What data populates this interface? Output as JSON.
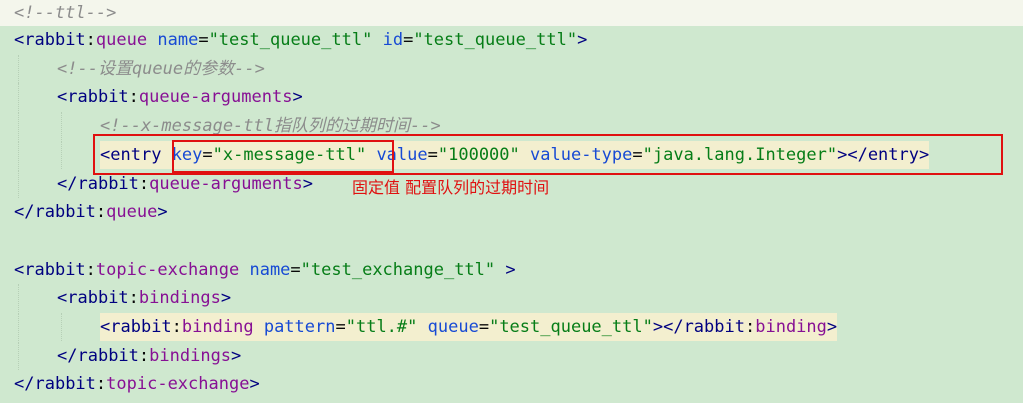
{
  "lines": [
    {
      "indent": 0,
      "tokens": [
        {
          "t": "<!--ttl-->",
          "c": "cm"
        }
      ]
    },
    {
      "indent": 0,
      "tokens": [
        {
          "t": "<",
          "c": "tg"
        },
        {
          "t": "rabbit",
          "c": "tg"
        },
        {
          "t": ":",
          "c": "pl"
        },
        {
          "t": "queue",
          "c": "ns"
        },
        {
          "t": " ",
          "c": "pl"
        },
        {
          "t": "name",
          "c": "an"
        },
        {
          "t": "=",
          "c": "pl"
        },
        {
          "t": "\"test_queue_ttl\"",
          "c": "av"
        },
        {
          "t": " ",
          "c": "pl"
        },
        {
          "t": "id",
          "c": "an"
        },
        {
          "t": "=",
          "c": "pl"
        },
        {
          "t": "\"test_queue_ttl\"",
          "c": "av"
        },
        {
          "t": ">",
          "c": "tg"
        }
      ]
    },
    {
      "indent": 1,
      "tokens": [
        {
          "t": "<!--设置queue的参数-->",
          "c": "cm"
        }
      ]
    },
    {
      "indent": 1,
      "tokens": [
        {
          "t": "<",
          "c": "tg"
        },
        {
          "t": "rabbit",
          "c": "tg"
        },
        {
          "t": ":",
          "c": "pl"
        },
        {
          "t": "queue-arguments",
          "c": "ns"
        },
        {
          "t": ">",
          "c": "tg"
        }
      ]
    },
    {
      "indent": 2,
      "tokens": [
        {
          "t": "<!--x-message-ttl指队列的过期时间-->",
          "c": "cm"
        }
      ]
    },
    {
      "indent": 2,
      "highlight": true,
      "tokens": [
        {
          "t": "<",
          "c": "tg"
        },
        {
          "t": "entry",
          "c": "tg"
        },
        {
          "t": " ",
          "c": "pl"
        },
        {
          "t": "key",
          "c": "an"
        },
        {
          "t": "=",
          "c": "pl"
        },
        {
          "t": "\"x-message-ttl\"",
          "c": "av"
        },
        {
          "t": " ",
          "c": "pl"
        },
        {
          "t": "value",
          "c": "an"
        },
        {
          "t": "=",
          "c": "pl"
        },
        {
          "t": "\"100000\"",
          "c": "av"
        },
        {
          "t": " ",
          "c": "pl"
        },
        {
          "t": "value-type",
          "c": "an"
        },
        {
          "t": "=",
          "c": "pl"
        },
        {
          "t": "\"java.lang.Integer\"",
          "c": "av"
        },
        {
          "t": "></",
          "c": "tg"
        },
        {
          "t": "entry",
          "c": "tg"
        },
        {
          "t": ">",
          "c": "tg"
        }
      ]
    },
    {
      "indent": 1,
      "tokens": [
        {
          "t": "</",
          "c": "tg"
        },
        {
          "t": "rabbit",
          "c": "tg"
        },
        {
          "t": ":",
          "c": "pl"
        },
        {
          "t": "queue-arguments",
          "c": "ns"
        },
        {
          "t": ">",
          "c": "tg"
        }
      ]
    },
    {
      "indent": 0,
      "tokens": [
        {
          "t": "</",
          "c": "tg"
        },
        {
          "t": "rabbit",
          "c": "tg"
        },
        {
          "t": ":",
          "c": "pl"
        },
        {
          "t": "queue",
          "c": "ns"
        },
        {
          "t": ">",
          "c": "tg"
        }
      ]
    },
    {
      "indent": 0,
      "tokens": []
    },
    {
      "indent": 0,
      "tokens": [
        {
          "t": "<",
          "c": "tg"
        },
        {
          "t": "rabbit",
          "c": "tg"
        },
        {
          "t": ":",
          "c": "pl"
        },
        {
          "t": "topic-exchange",
          "c": "ns"
        },
        {
          "t": " ",
          "c": "pl"
        },
        {
          "t": "name",
          "c": "an"
        },
        {
          "t": "=",
          "c": "pl"
        },
        {
          "t": "\"test_exchange_ttl\"",
          "c": "av"
        },
        {
          "t": " >",
          "c": "tg"
        }
      ]
    },
    {
      "indent": 1,
      "tokens": [
        {
          "t": "<",
          "c": "tg"
        },
        {
          "t": "rabbit",
          "c": "tg"
        },
        {
          "t": ":",
          "c": "pl"
        },
        {
          "t": "bindings",
          "c": "ns"
        },
        {
          "t": ">",
          "c": "tg"
        }
      ]
    },
    {
      "indent": 2,
      "highlight": true,
      "tokens": [
        {
          "t": "<",
          "c": "tg"
        },
        {
          "t": "rabbit",
          "c": "tg"
        },
        {
          "t": ":",
          "c": "pl"
        },
        {
          "t": "binding",
          "c": "ns"
        },
        {
          "t": " ",
          "c": "pl"
        },
        {
          "t": "pattern",
          "c": "an"
        },
        {
          "t": "=",
          "c": "pl"
        },
        {
          "t": "\"ttl.#\"",
          "c": "av"
        },
        {
          "t": " ",
          "c": "pl"
        },
        {
          "t": "queue",
          "c": "an"
        },
        {
          "t": "=",
          "c": "pl"
        },
        {
          "t": "\"test_queue_ttl\"",
          "c": "av"
        },
        {
          "t": "></",
          "c": "tg"
        },
        {
          "t": "rabbit",
          "c": "tg"
        },
        {
          "t": ":",
          "c": "pl"
        },
        {
          "t": "binding",
          "c": "ns"
        },
        {
          "t": ">",
          "c": "tg"
        }
      ]
    },
    {
      "indent": 1,
      "tokens": [
        {
          "t": "</",
          "c": "tg"
        },
        {
          "t": "rabbit",
          "c": "tg"
        },
        {
          "t": ":",
          "c": "pl"
        },
        {
          "t": "bindings",
          "c": "ns"
        },
        {
          "t": ">",
          "c": "tg"
        }
      ]
    },
    {
      "indent": 0,
      "tokens": [
        {
          "t": "</",
          "c": "tg"
        },
        {
          "t": "rabbit",
          "c": "tg"
        },
        {
          "t": ":",
          "c": "pl"
        },
        {
          "t": "topic-exchange",
          "c": "ns"
        },
        {
          "t": ">",
          "c": "tg"
        }
      ]
    }
  ],
  "annotation": {
    "note": "固定值 配置队列的过期时间"
  }
}
